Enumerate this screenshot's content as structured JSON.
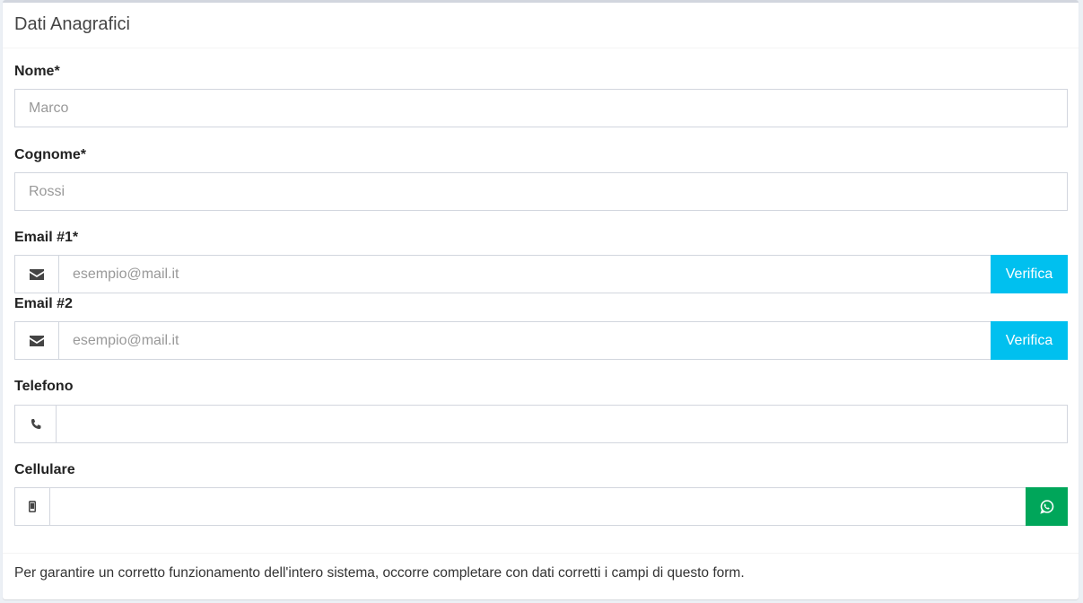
{
  "header": {
    "title": "Dati Anagrafici"
  },
  "form": {
    "nome": {
      "label": "Nome*",
      "placeholder": "Marco"
    },
    "cognome": {
      "label": "Cognome*",
      "placeholder": "Rossi"
    },
    "email1": {
      "label": "Email #1*",
      "placeholder": "esempio@mail.it",
      "verify_label": "Verifica",
      "icon": "envelope-icon"
    },
    "email2": {
      "label": "Email #2",
      "placeholder": "esempio@mail.it",
      "verify_label": "Verifica",
      "icon": "envelope-icon"
    },
    "telefono": {
      "label": "Telefono",
      "placeholder": "",
      "icon": "phone-icon"
    },
    "cellulare": {
      "label": "Cellulare",
      "placeholder": "",
      "icon": "mobile-icon",
      "action_icon": "whatsapp-icon"
    }
  },
  "footer": {
    "note": "Per garantire un corretto funzionamento dell'intero sistema, occorre completare con dati corretti i campi di questo form."
  },
  "colors": {
    "verify_button": "#00c0ef",
    "whatsapp_button": "#00a65a",
    "border": "#d2d6de"
  }
}
